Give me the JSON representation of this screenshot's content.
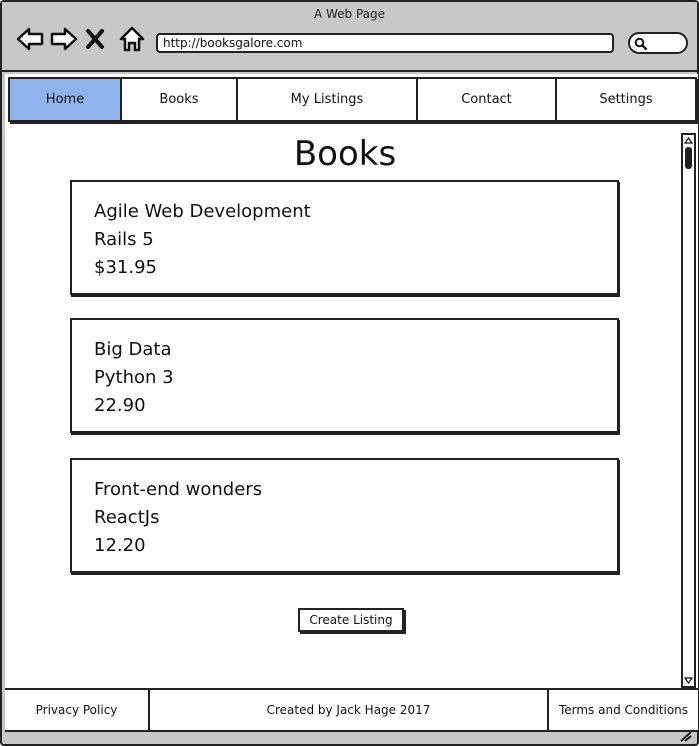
{
  "window": {
    "title": "A Web Page",
    "url": "http://booksgalore.com"
  },
  "nav": {
    "tabs": [
      {
        "label": "Home",
        "active": true
      },
      {
        "label": "Books",
        "active": false
      },
      {
        "label": "My Listings",
        "active": false
      },
      {
        "label": "Contact",
        "active": false
      },
      {
        "label": "Settings",
        "active": false
      }
    ]
  },
  "main": {
    "title": "Books",
    "books": [
      {
        "title": "Agile Web Development",
        "subtitle": "Rails 5",
        "price": "$31.95"
      },
      {
        "title": "Big Data",
        "subtitle": "Python 3",
        "price": "22.90"
      },
      {
        "title": "Front-end wonders",
        "subtitle": "ReactJs",
        "price": "12.20"
      }
    ],
    "create_label": "Create Listing"
  },
  "footer": {
    "privacy": "Privacy Policy",
    "credit": "Created by Jack Hage 2017",
    "terms": "Terms and Conditions"
  },
  "colors": {
    "active_tab": "#8fb4ec",
    "chrome": "#c8c8c8"
  }
}
